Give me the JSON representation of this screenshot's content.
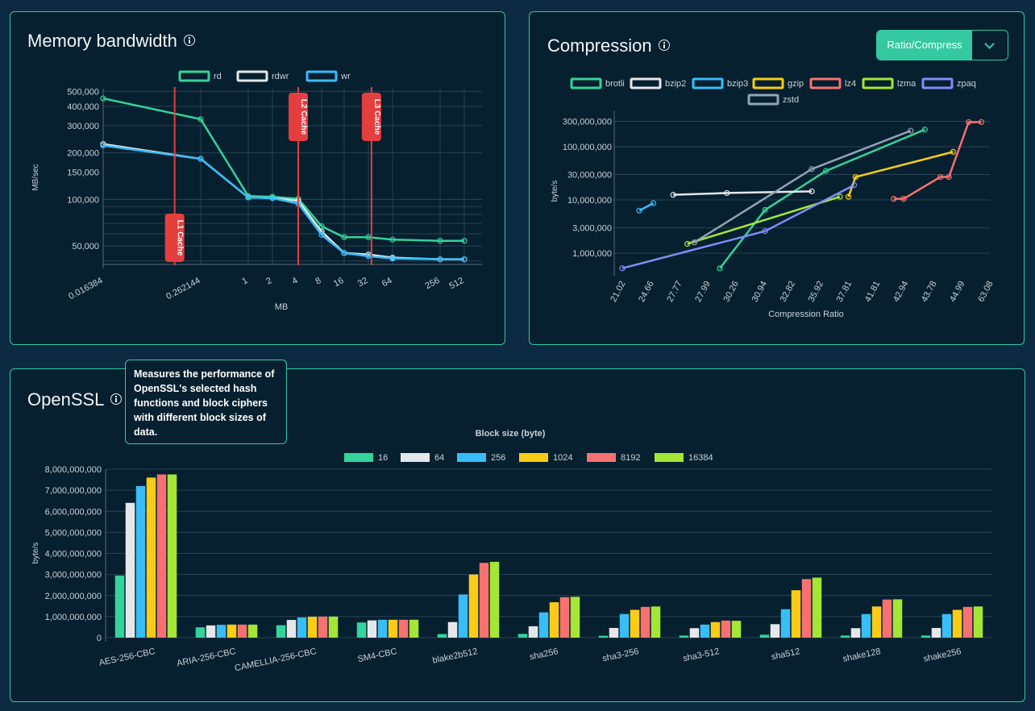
{
  "memory": {
    "title": "Memory bandwidth",
    "chart_data": {
      "type": "line",
      "x_scale": "log",
      "y_scale": "log",
      "xlabel": "MB",
      "ylabel": "MB/sec",
      "x_ticks": [
        "0.016384",
        "0.262144",
        "1",
        "2",
        "4",
        "8",
        "16",
        "32",
        "64",
        "256",
        "512"
      ],
      "x_values": [
        0.016384,
        0.262144,
        1,
        2,
        4,
        8,
        16,
        32,
        64,
        256,
        512
      ],
      "y_ticks": [
        "500,000",
        "400,000",
        "300,000",
        "200,000",
        "150,000",
        "100,000",
        "50,000"
      ],
      "y_tick_values": [
        500000,
        400000,
        300000,
        200000,
        150000,
        100000,
        50000
      ],
      "ylim": [
        38000,
        520000
      ],
      "series": [
        {
          "name": "rd",
          "color": "#34d399",
          "x": [
            0.016384,
            0.262144,
            1,
            2,
            4,
            8,
            16,
            32,
            64,
            256,
            512
          ],
          "values": [
            450000,
            330000,
            105000,
            104000,
            101000,
            67000,
            57000,
            57000,
            55000,
            54000,
            54000
          ]
        },
        {
          "name": "rdwr",
          "color": "#e5e7eb",
          "x": [
            0.016384,
            0.262144,
            1,
            2,
            4,
            8,
            16,
            32,
            64,
            256,
            512
          ],
          "values": [
            228000,
            183000,
            103000,
            102000,
            98000,
            62000,
            45000,
            44000,
            42000,
            41000,
            41000
          ]
        },
        {
          "name": "wr",
          "color": "#38bdf8",
          "x": [
            0.016384,
            0.262144,
            1,
            2,
            4,
            8,
            16,
            32,
            64,
            256,
            512
          ],
          "values": [
            223000,
            183000,
            103000,
            102000,
            94000,
            59000,
            45000,
            43000,
            41500,
            41000,
            41000
          ]
        }
      ],
      "annotations": [
        {
          "label": "L1 Cache",
          "x": 0.125
        },
        {
          "label": "L2 Cache",
          "x": 4
        },
        {
          "label": "L3 Cache",
          "x": 35
        }
      ]
    }
  },
  "compression": {
    "title": "Compression",
    "dropdown_label": "Ratio/Compress",
    "chart_data": {
      "type": "line",
      "y_scale": "log",
      "xlabel": "Compression Ratio",
      "ylabel": "byte/s",
      "x_ticks": [
        "21.02",
        "24.66",
        "27.77",
        "27.99",
        "30.26",
        "30.94",
        "32.82",
        "35.92",
        "37.81",
        "41.81",
        "42.94",
        "43.78",
        "44.99",
        "63.08"
      ],
      "y_ticks": [
        "300,000,000",
        "100,000,000",
        "30,000,000",
        "10,000,000",
        "3,000,000",
        "1,000,000"
      ],
      "y_tick_values": [
        300000000,
        100000000,
        30000000,
        10000000,
        3000000,
        1000000
      ],
      "ylim": [
        450000,
        480000000
      ],
      "series": [
        {
          "name": "brotli",
          "color": "#34d399",
          "x": [
            3.45,
            5.05,
            7.2,
            10.7
          ],
          "values": [
            520000,
            6500000,
            35000000,
            210000000
          ]
        },
        {
          "name": "bzip2",
          "color": "#e5e7eb",
          "x": [
            1.8,
            3.7,
            6.7
          ],
          "values": [
            12500000,
            13500000,
            14500000
          ]
        },
        {
          "name": "bzip3",
          "color": "#38bdf8",
          "x": [
            0.6,
            1.1
          ],
          "values": [
            6300000,
            8700000
          ]
        },
        {
          "name": "gzip",
          "color": "#facc15",
          "x": [
            8.0,
            8.25,
            11.7
          ],
          "values": [
            11500000,
            27000000,
            80000000
          ]
        },
        {
          "name": "lz4",
          "color": "#f87171",
          "x": [
            9.6,
            9.95,
            11.25,
            11.55,
            12.25,
            12.7
          ],
          "values": [
            10500000,
            10500000,
            27000000,
            27000000,
            290000000,
            290000000
          ]
        },
        {
          "name": "lzma",
          "color": "#a3e635",
          "x": [
            2.3,
            7.7
          ],
          "values": [
            1500000,
            11500000
          ]
        },
        {
          "name": "zpaq",
          "color": "#818cf8",
          "x": [
            0.0,
            5.05,
            8.2
          ],
          "values": [
            520000,
            2600000,
            19000000
          ]
        },
        {
          "name": "zstd",
          "color": "#94a3b8",
          "x": [
            2.55,
            6.7,
            10.2
          ],
          "values": [
            1600000,
            38000000,
            200000000
          ]
        }
      ]
    }
  },
  "openssl": {
    "title": "OpenSSL",
    "tooltip": "Measures the performance of OpenSSL's selected hash functions and block ciphers with different block sizes of data.",
    "chart_data": {
      "type": "bar",
      "title": "Block size (byte)",
      "ylabel": "byte/s",
      "ylim": [
        0,
        8000000000
      ],
      "y_ticks": [
        "8,000,000,000",
        "7,000,000,000",
        "6,000,000,000",
        "5,000,000,000",
        "4,000,000,000",
        "3,000,000,000",
        "2,000,000,000",
        "1,000,000,000",
        "0"
      ],
      "y_tick_values": [
        8000000000,
        7000000000,
        6000000000,
        5000000000,
        4000000000,
        3000000000,
        2000000000,
        1000000000,
        0
      ],
      "categories": [
        "AES-256-CBC",
        "ARIA-256-CBC",
        "CAMELLIA-256-CBC",
        "SM4-CBC",
        "blake2b512",
        "sha256",
        "sha3-256",
        "sha3-512",
        "sha512",
        "shake128",
        "shake256"
      ],
      "series": [
        {
          "name": "16",
          "color": "#34d399",
          "values": [
            2950000000,
            490000000,
            590000000,
            720000000,
            170000000,
            180000000,
            90000000,
            100000000,
            140000000,
            100000000,
            100000000
          ]
        },
        {
          "name": "64",
          "color": "#e5e7eb",
          "values": [
            6400000000,
            580000000,
            840000000,
            820000000,
            740000000,
            540000000,
            460000000,
            450000000,
            640000000,
            450000000,
            460000000
          ]
        },
        {
          "name": "256",
          "color": "#38bdf8",
          "values": [
            7200000000,
            610000000,
            960000000,
            850000000,
            2050000000,
            1200000000,
            1120000000,
            620000000,
            1350000000,
            1120000000,
            1120000000
          ]
        },
        {
          "name": "1024",
          "color": "#facc15",
          "values": [
            7600000000,
            620000000,
            990000000,
            850000000,
            3000000000,
            1680000000,
            1320000000,
            740000000,
            2250000000,
            1480000000,
            1320000000
          ]
        },
        {
          "name": "8192",
          "color": "#f87171",
          "values": [
            7750000000,
            620000000,
            1000000000,
            850000000,
            3550000000,
            1920000000,
            1460000000,
            810000000,
            2780000000,
            1810000000,
            1460000000
          ]
        },
        {
          "name": "16384",
          "color": "#a3e635",
          "values": [
            7750000000,
            620000000,
            1000000000,
            850000000,
            3600000000,
            1940000000,
            1480000000,
            800000000,
            2850000000,
            1820000000,
            1480000000
          ]
        }
      ]
    }
  }
}
